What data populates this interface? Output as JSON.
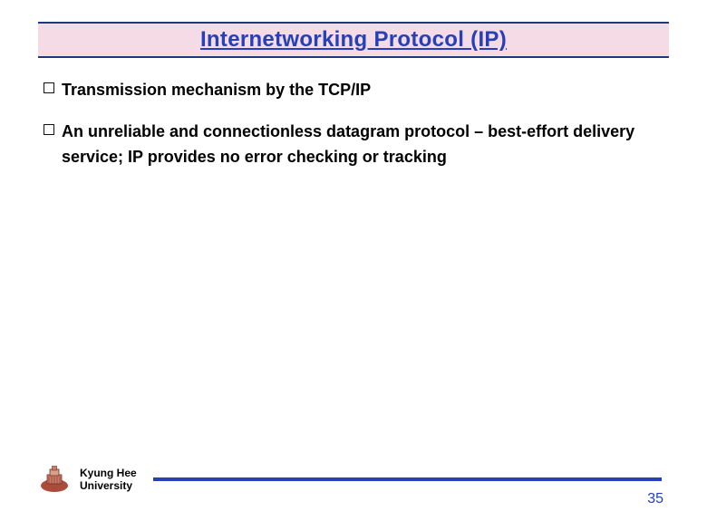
{
  "slide": {
    "title": "Internetworking Protocol (IP)",
    "bullets": [
      "Transmission mechanism by the TCP/IP",
      "An unreliable and connectionless datagram protocol – best-effort delivery service; IP provides no error checking or tracking"
    ]
  },
  "footer": {
    "institution_line1": "Kyung Hee",
    "institution_line2": "University",
    "page_number": "35"
  },
  "colors": {
    "title_bg": "#f4dbe6",
    "accent": "#2540b8",
    "border": "#1a3a7a"
  }
}
